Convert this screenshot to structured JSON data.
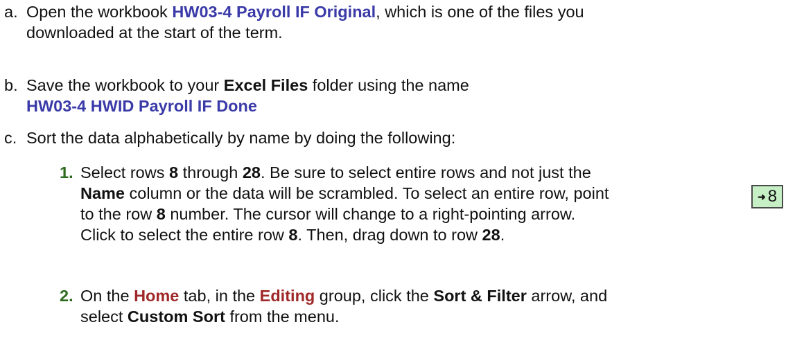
{
  "steps": {
    "a": {
      "letter": "a.",
      "t1": "Open the workbook ",
      "file": "HW03-4 Payroll IF Original",
      "t2": ", which is one of the files you",
      "t3": "downloaded at the start of the term."
    },
    "b": {
      "letter": "b.",
      "t1": "Save the workbook to your ",
      "folder": "Excel Files",
      "t2": " folder using the name",
      "filename": "HW03-4 HWID Payroll IF Done"
    },
    "c": {
      "letter": "c.",
      "t1": "Sort the data alphabetically by name by doing the following:"
    }
  },
  "substeps": [
    {
      "num": "1.",
      "p1": "Select rows ",
      "r8": "8",
      "p2": " through ",
      "r28": "28",
      "p3": ". Be sure to select entire rows and not just the",
      "name": "Name",
      "p4": " column or the data will be scrambled. To select an entire row, point",
      "p5": "to the row ",
      "r8b": "8",
      "p6": " number. The cursor will change to a right-pointing arrow.",
      "p7": "Click to select the entire row ",
      "r8c": "8",
      "p8": ". Then, drag down to row ",
      "r28b": "28",
      "p9": "."
    },
    {
      "num": "2.",
      "p1": "On the ",
      "home": "Home",
      "p2": " tab, in the ",
      "editing": "Editing",
      "p3": " group, click the ",
      "sortfilter": "Sort & Filter",
      "p4": " arrow, and",
      "p5": "select ",
      "customsort": "Custom Sort",
      "p6": " from the menu."
    }
  ],
  "row_badge": {
    "arrow_icon": "right-arrow-icon",
    "label": "8",
    "bg_color": "#c6efc6"
  },
  "colors": {
    "blue_highlight": "#3a3aa8",
    "red_highlight": "#a02828",
    "step_number": "#2f6b1f"
  }
}
